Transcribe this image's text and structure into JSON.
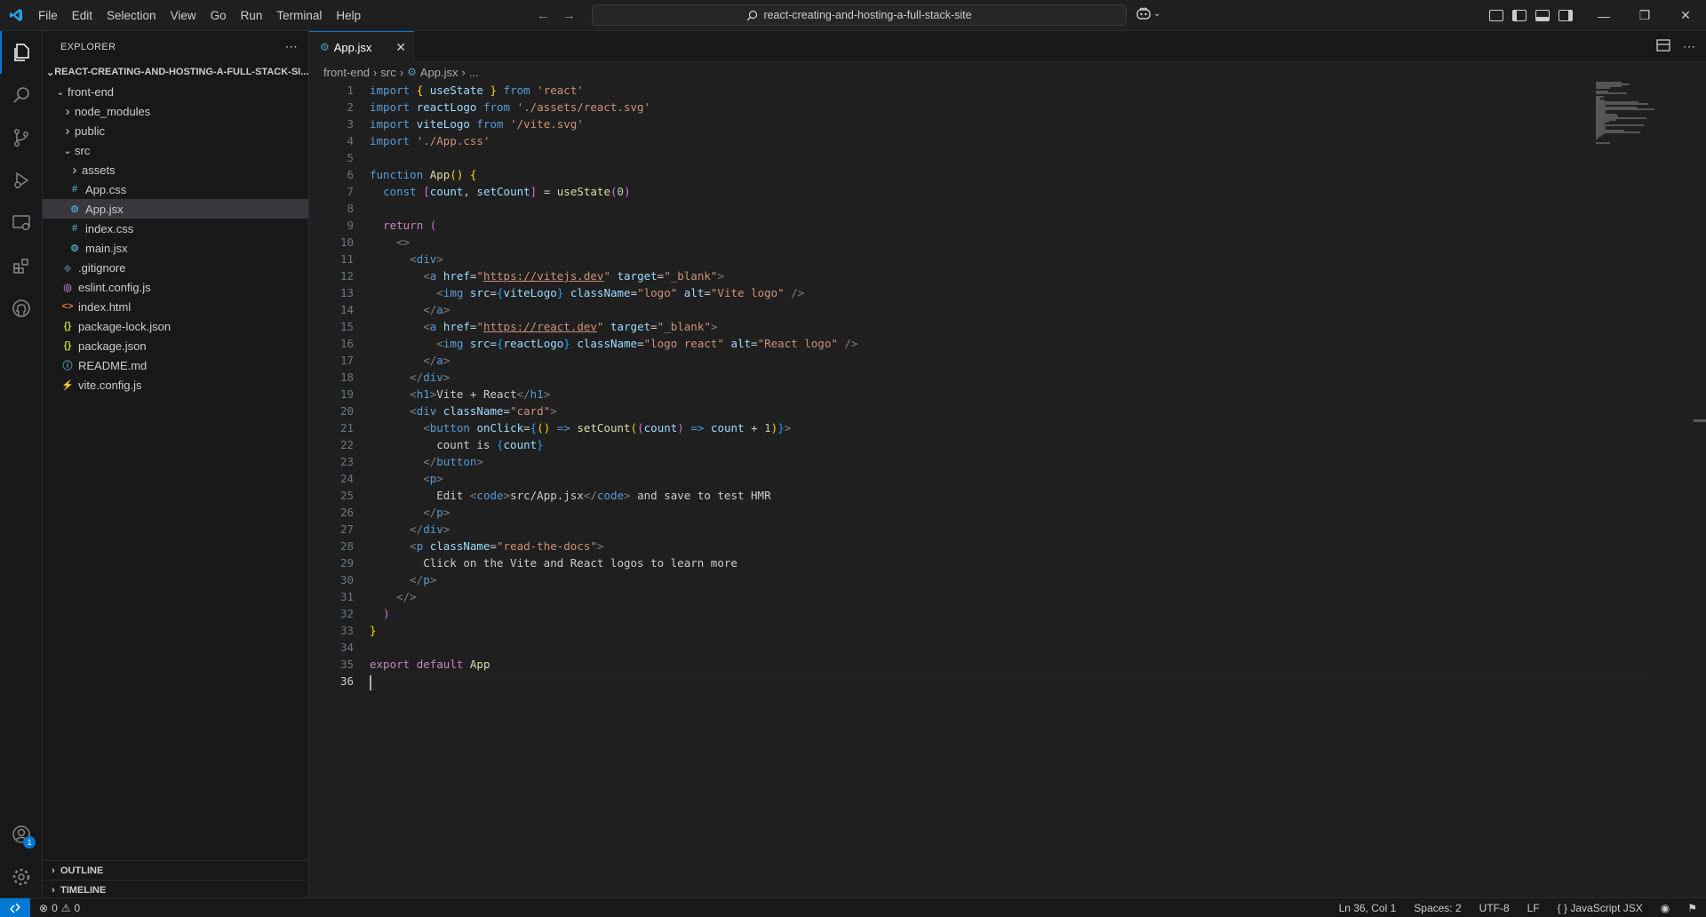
{
  "titlebar": {
    "menu": [
      "File",
      "Edit",
      "Selection",
      "View",
      "Go",
      "Run",
      "Terminal",
      "Help"
    ],
    "search_text": "react-creating-and-hosting-a-full-stack-site"
  },
  "sidebar": {
    "title": "EXPLORER",
    "root": "REACT-CREATING-AND-HOSTING-A-FULL-STACK-SI...",
    "items": [
      {
        "label": "front-end",
        "kind": "folder-open",
        "depth": 1
      },
      {
        "label": "node_modules",
        "kind": "folder",
        "depth": 2
      },
      {
        "label": "public",
        "kind": "folder",
        "depth": 2
      },
      {
        "label": "src",
        "kind": "folder-open",
        "depth": 2
      },
      {
        "label": "assets",
        "kind": "folder",
        "depth": 3
      },
      {
        "label": "App.css",
        "kind": "css",
        "depth": 3
      },
      {
        "label": "App.jsx",
        "kind": "jsx",
        "depth": 3,
        "selected": true
      },
      {
        "label": "index.css",
        "kind": "css",
        "depth": 3
      },
      {
        "label": "main.jsx",
        "kind": "jsx",
        "depth": 3
      },
      {
        "label": ".gitignore",
        "kind": "git",
        "depth": 2
      },
      {
        "label": "eslint.config.js",
        "kind": "eslint",
        "depth": 2
      },
      {
        "label": "index.html",
        "kind": "html",
        "depth": 2
      },
      {
        "label": "package-lock.json",
        "kind": "json",
        "depth": 2
      },
      {
        "label": "package.json",
        "kind": "json",
        "depth": 2
      },
      {
        "label": "README.md",
        "kind": "info",
        "depth": 2
      },
      {
        "label": "vite.config.js",
        "kind": "vite",
        "depth": 2
      }
    ],
    "outline": "OUTLINE",
    "timeline": "TIMELINE"
  },
  "editor": {
    "tab": "App.jsx",
    "breadcrumb": [
      "front-end",
      "src",
      "App.jsx",
      "..."
    ],
    "cursor_line": 36,
    "lines": [
      [
        [
          "kw",
          "import "
        ],
        [
          "bk",
          "{ "
        ],
        [
          "vr",
          "useState"
        ],
        [
          "bk",
          " }"
        ],
        [
          "kw",
          " from "
        ],
        [
          "st",
          "'react'"
        ]
      ],
      [
        [
          "kw",
          "import "
        ],
        [
          "vr",
          "reactLogo"
        ],
        [
          "kw",
          " from "
        ],
        [
          "st",
          "'./assets/react.svg'"
        ]
      ],
      [
        [
          "kw",
          "import "
        ],
        [
          "vr",
          "viteLogo"
        ],
        [
          "kw",
          " from "
        ],
        [
          "st",
          "'/vite.svg'"
        ]
      ],
      [
        [
          "kw",
          "import "
        ],
        [
          "st",
          "'./App.css'"
        ]
      ],
      [],
      [
        [
          "kw",
          "function "
        ],
        [
          "fn",
          "App"
        ],
        [
          "bk",
          "() {"
        ]
      ],
      [
        [
          "tx",
          "  "
        ],
        [
          "kw",
          "const "
        ],
        [
          "bk2",
          "["
        ],
        [
          "vr",
          "count"
        ],
        [
          "tx",
          ", "
        ],
        [
          "vr",
          "setCount"
        ],
        [
          "bk2",
          "]"
        ],
        [
          "tx",
          " = "
        ],
        [
          "fn",
          "useState"
        ],
        [
          "bk2",
          "("
        ],
        [
          "nm",
          "0"
        ],
        [
          "bk2",
          ")"
        ]
      ],
      [],
      [
        [
          "tx",
          "  "
        ],
        [
          "kc",
          "return "
        ],
        [
          "bk2",
          "("
        ]
      ],
      [
        [
          "tx",
          "    "
        ],
        [
          "pn",
          "<>"
        ]
      ],
      [
        [
          "tx",
          "      "
        ],
        [
          "pn",
          "<"
        ],
        [
          "tg",
          "div"
        ],
        [
          "pn",
          ">"
        ]
      ],
      [
        [
          "tx",
          "        "
        ],
        [
          "pn",
          "<"
        ],
        [
          "tg",
          "a "
        ],
        [
          "ta",
          "href"
        ],
        [
          "tx",
          "="
        ],
        [
          "st",
          "\""
        ],
        [
          "lk",
          "https://vitejs.dev"
        ],
        [
          "st",
          "\""
        ],
        [
          "ta",
          " target"
        ],
        [
          "tx",
          "="
        ],
        [
          "st",
          "\"_blank\""
        ],
        [
          "pn",
          ">"
        ]
      ],
      [
        [
          "tx",
          "          "
        ],
        [
          "pn",
          "<"
        ],
        [
          "tg",
          "img "
        ],
        [
          "ta",
          "src"
        ],
        [
          "tx",
          "="
        ],
        [
          "bk3",
          "{"
        ],
        [
          "vr",
          "viteLogo"
        ],
        [
          "bk3",
          "}"
        ],
        [
          "ta",
          " className"
        ],
        [
          "tx",
          "="
        ],
        [
          "st",
          "\"logo\""
        ],
        [
          "ta",
          " alt"
        ],
        [
          "tx",
          "="
        ],
        [
          "st",
          "\"Vite logo\""
        ],
        [
          "pn",
          " />"
        ]
      ],
      [
        [
          "tx",
          "        "
        ],
        [
          "pn",
          "</"
        ],
        [
          "tg",
          "a"
        ],
        [
          "pn",
          ">"
        ]
      ],
      [
        [
          "tx",
          "        "
        ],
        [
          "pn",
          "<"
        ],
        [
          "tg",
          "a "
        ],
        [
          "ta",
          "href"
        ],
        [
          "tx",
          "="
        ],
        [
          "st",
          "\""
        ],
        [
          "lk",
          "https://react.dev"
        ],
        [
          "st",
          "\""
        ],
        [
          "ta",
          " target"
        ],
        [
          "tx",
          "="
        ],
        [
          "st",
          "\"_blank\""
        ],
        [
          "pn",
          ">"
        ]
      ],
      [
        [
          "tx",
          "          "
        ],
        [
          "pn",
          "<"
        ],
        [
          "tg",
          "img "
        ],
        [
          "ta",
          "src"
        ],
        [
          "tx",
          "="
        ],
        [
          "bk3",
          "{"
        ],
        [
          "vr",
          "reactLogo"
        ],
        [
          "bk3",
          "}"
        ],
        [
          "ta",
          " className"
        ],
        [
          "tx",
          "="
        ],
        [
          "st",
          "\"logo react\""
        ],
        [
          "ta",
          " alt"
        ],
        [
          "tx",
          "="
        ],
        [
          "st",
          "\"React logo\""
        ],
        [
          "pn",
          " />"
        ]
      ],
      [
        [
          "tx",
          "        "
        ],
        [
          "pn",
          "</"
        ],
        [
          "tg",
          "a"
        ],
        [
          "pn",
          ">"
        ]
      ],
      [
        [
          "tx",
          "      "
        ],
        [
          "pn",
          "</"
        ],
        [
          "tg",
          "div"
        ],
        [
          "pn",
          ">"
        ]
      ],
      [
        [
          "tx",
          "      "
        ],
        [
          "pn",
          "<"
        ],
        [
          "tg",
          "h1"
        ],
        [
          "pn",
          ">"
        ],
        [
          "tx",
          "Vite + React"
        ],
        [
          "pn",
          "</"
        ],
        [
          "tg",
          "h1"
        ],
        [
          "pn",
          ">"
        ]
      ],
      [
        [
          "tx",
          "      "
        ],
        [
          "pn",
          "<"
        ],
        [
          "tg",
          "div "
        ],
        [
          "ta",
          "className"
        ],
        [
          "tx",
          "="
        ],
        [
          "st",
          "\"card\""
        ],
        [
          "pn",
          ">"
        ]
      ],
      [
        [
          "tx",
          "        "
        ],
        [
          "pn",
          "<"
        ],
        [
          "tg",
          "button "
        ],
        [
          "ta",
          "onClick"
        ],
        [
          "tx",
          "="
        ],
        [
          "bk3",
          "{"
        ],
        [
          "bk",
          "()"
        ],
        [
          "kw",
          " => "
        ],
        [
          "fn",
          "setCount"
        ],
        [
          "bk",
          "("
        ],
        [
          "bk2",
          "("
        ],
        [
          "vr",
          "count"
        ],
        [
          "bk2",
          ")"
        ],
        [
          "kw",
          " => "
        ],
        [
          "vr",
          "count"
        ],
        [
          "tx",
          " + "
        ],
        [
          "nm",
          "1"
        ],
        [
          "bk",
          ")"
        ],
        [
          "bk3",
          "}"
        ],
        [
          "pn",
          ">"
        ]
      ],
      [
        [
          "tx",
          "          count is "
        ],
        [
          "bk3",
          "{"
        ],
        [
          "vr",
          "count"
        ],
        [
          "bk3",
          "}"
        ]
      ],
      [
        [
          "tx",
          "        "
        ],
        [
          "pn",
          "</"
        ],
        [
          "tg",
          "button"
        ],
        [
          "pn",
          ">"
        ]
      ],
      [
        [
          "tx",
          "        "
        ],
        [
          "pn",
          "<"
        ],
        [
          "tg",
          "p"
        ],
        [
          "pn",
          ">"
        ]
      ],
      [
        [
          "tx",
          "          Edit "
        ],
        [
          "pn",
          "<"
        ],
        [
          "tg",
          "code"
        ],
        [
          "pn",
          ">"
        ],
        [
          "tx",
          "src/App.jsx"
        ],
        [
          "pn",
          "</"
        ],
        [
          "tg",
          "code"
        ],
        [
          "pn",
          ">"
        ],
        [
          "tx",
          " and save to test HMR"
        ]
      ],
      [
        [
          "tx",
          "        "
        ],
        [
          "pn",
          "</"
        ],
        [
          "tg",
          "p"
        ],
        [
          "pn",
          ">"
        ]
      ],
      [
        [
          "tx",
          "      "
        ],
        [
          "pn",
          "</"
        ],
        [
          "tg",
          "div"
        ],
        [
          "pn",
          ">"
        ]
      ],
      [
        [
          "tx",
          "      "
        ],
        [
          "pn",
          "<"
        ],
        [
          "tg",
          "p "
        ],
        [
          "ta",
          "className"
        ],
        [
          "tx",
          "="
        ],
        [
          "st",
          "\"read-the-docs\""
        ],
        [
          "pn",
          ">"
        ]
      ],
      [
        [
          "tx",
          "        Click on the Vite and React logos to learn more"
        ]
      ],
      [
        [
          "tx",
          "      "
        ],
        [
          "pn",
          "</"
        ],
        [
          "tg",
          "p"
        ],
        [
          "pn",
          ">"
        ]
      ],
      [
        [
          "tx",
          "    "
        ],
        [
          "pn",
          "</>"
        ]
      ],
      [
        [
          "tx",
          "  "
        ],
        [
          "bk2",
          ")"
        ]
      ],
      [
        [
          "bk",
          "}"
        ]
      ],
      [],
      [
        [
          "kc",
          "export "
        ],
        [
          "kc",
          "default "
        ],
        [
          "fn",
          "App"
        ]
      ],
      []
    ]
  },
  "statusbar": {
    "errors": "0",
    "warnings": "0",
    "position": "Ln 36, Col 1",
    "spaces": "Spaces: 2",
    "encoding": "UTF-8",
    "eol": "LF",
    "language": "JavaScript JSX"
  },
  "accounts_badge": "1"
}
